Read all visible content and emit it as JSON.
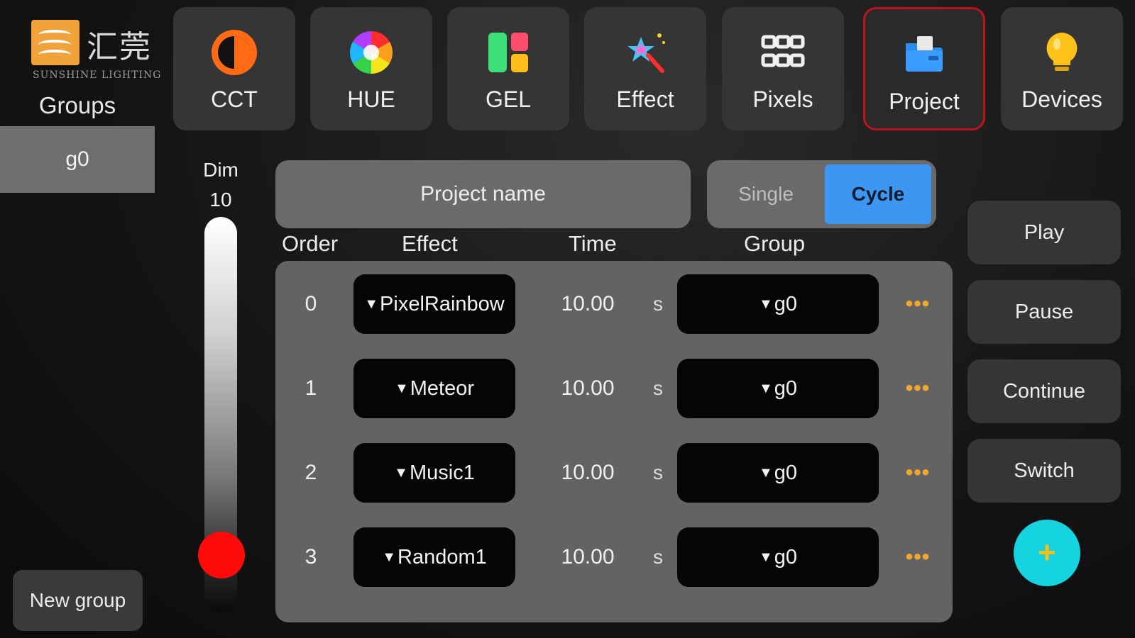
{
  "brand": {
    "logo_cn": "汇莞",
    "logo_en": "SUNSHINE LIGHTING",
    "accent_color": "#f2a23a"
  },
  "sidebar": {
    "title": "Groups",
    "groups": [
      {
        "label": "g0",
        "selected": true
      }
    ],
    "new_group_label": "New group"
  },
  "tabs": [
    {
      "label": "CCT",
      "icon": "half-circle-icon",
      "active": false
    },
    {
      "label": "HUE",
      "icon": "color-wheel-icon",
      "active": false
    },
    {
      "label": "GEL",
      "icon": "gel-swatches-icon",
      "active": false
    },
    {
      "label": "Effect",
      "icon": "magic-wand-star-icon",
      "active": false
    },
    {
      "label": "Pixels",
      "icon": "pixel-grid-icon",
      "active": false
    },
    {
      "label": "Project",
      "icon": "folder-icon",
      "active": true
    },
    {
      "label": "Devices",
      "icon": "lightbulb-icon",
      "active": false
    }
  ],
  "dim": {
    "label": "Dim",
    "value": "10",
    "level": 0.1,
    "knob_color": "#ff0a0a"
  },
  "project": {
    "name_placeholder": "Project name",
    "mode_options": [
      "Single",
      "Cycle"
    ],
    "mode_selected": "Cycle",
    "selected_color": "#3c96f2"
  },
  "table": {
    "headers": {
      "order": "Order",
      "effect": "Effect",
      "time": "Time",
      "group": "Group"
    },
    "rows": [
      {
        "order": "0",
        "effect": "PixelRainbow",
        "time": "10.00",
        "unit": "s",
        "group": "g0",
        "more": "•••"
      },
      {
        "order": "1",
        "effect": "Meteor",
        "time": "10.00",
        "unit": "s",
        "group": "g0",
        "more": "•••"
      },
      {
        "order": "2",
        "effect": "Music1",
        "time": "10.00",
        "unit": "s",
        "group": "g0",
        "more": "•••"
      },
      {
        "order": "3",
        "effect": "Random1",
        "time": "10.00",
        "unit": "s",
        "group": "g0",
        "more": "•••"
      }
    ]
  },
  "controls": {
    "play": "Play",
    "pause": "Pause",
    "continue": "Continue",
    "switch": "Switch",
    "add": "+"
  }
}
